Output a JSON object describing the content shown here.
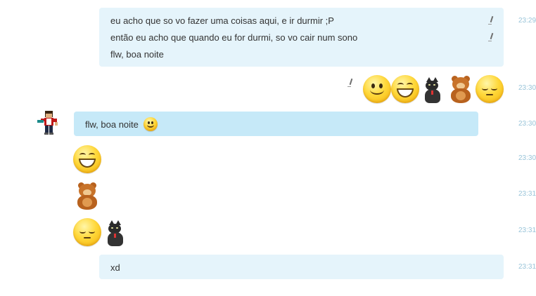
{
  "messages": {
    "block1": {
      "lines": [
        "eu acho que so vo fazer uma coisas aqui, e ir durmir ;P",
        "então eu acho que quando eu for durmi, so vo cair num sono",
        "flw, boa noite"
      ],
      "time": "23:29"
    },
    "emoji_row": {
      "time": "23:30",
      "icons": [
        "smile-icon",
        "grin-icon",
        "cat-icon",
        "bear-icon",
        "sleepy-icon"
      ]
    },
    "incoming1": {
      "text": "flw, boa noite",
      "time": "23:30"
    },
    "incoming_grin": {
      "time": "23:30"
    },
    "incoming_bear": {
      "time": "23:31"
    },
    "incoming_sleepy_cat": {
      "time": "23:31"
    },
    "outgoing_xd": {
      "text": "xd",
      "time": "23:31"
    }
  },
  "colors": {
    "outgoing_bubble": "#e5f4fb",
    "incoming_bubble": "#c6e9f8",
    "timestamp": "#98c4d9"
  }
}
